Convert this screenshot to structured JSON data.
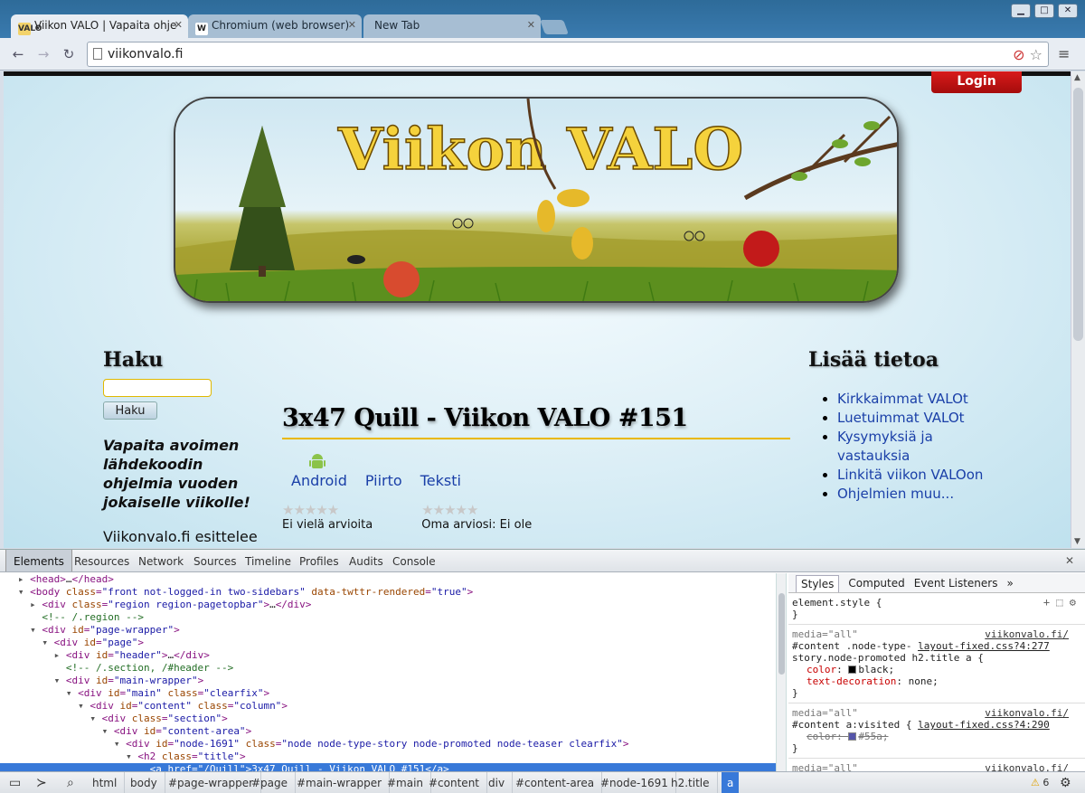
{
  "window": {
    "tabs": [
      {
        "title": "Viikon VALO | Vapaita ohje",
        "favicon": "VALO",
        "active": true
      },
      {
        "title": "Chromium (web browser)",
        "favicon": "W",
        "active": false
      },
      {
        "title": "New Tab",
        "favicon": "",
        "active": false
      }
    ]
  },
  "toolbar": {
    "url": "viikonvalo.fi"
  },
  "page": {
    "login_label": "Login",
    "banner_title": "Viikon VALO",
    "search": {
      "heading": "Haku",
      "button": "Haku"
    },
    "slogan": "Vapaita avoimen lähdekoodin ohjelmia vuoden jokaiselle viikolle!",
    "intro": "Viikonvalo.fi esittelee",
    "node": {
      "title": "3x47 Quill - Viikon VALO #151",
      "tags": [
        "Android",
        "Piirto",
        "Teksti"
      ],
      "rating_left": "Ei vielä arvioita",
      "rating_right": "Oma arviosi: Ei ole"
    },
    "more_info": {
      "heading": "Lisää tietoa",
      "links": [
        "Kirkkaimmat VALOt",
        "Luetuimmat VALOt",
        "Kysymyksiä ja vastauksia",
        "Linkitä viikon VALOon",
        "Ohjelmien muu..."
      ]
    }
  },
  "devtools": {
    "tabs": [
      "Elements",
      "Resources",
      "Network",
      "Sources",
      "Timeline",
      "Profiles",
      "Audits",
      "Console"
    ],
    "dom_lines": [
      {
        "indent": 2,
        "tri": "▸",
        "parts": [
          [
            "tag",
            "<head>"
          ],
          [
            "text",
            "…"
          ],
          [
            "tag",
            "</head>"
          ]
        ]
      },
      {
        "indent": 2,
        "tri": "▾",
        "parts": [
          [
            "tag",
            "<body "
          ],
          [
            "attr",
            "class"
          ],
          [
            "tag",
            "="
          ],
          [
            "val",
            "\"front not-logged-in two-sidebars\""
          ],
          [
            "tag",
            " "
          ],
          [
            "attr",
            "data-twttr-rendered"
          ],
          [
            "tag",
            "="
          ],
          [
            "val",
            "\"true\""
          ],
          [
            "tag",
            ">"
          ]
        ]
      },
      {
        "indent": 3,
        "tri": "▸",
        "parts": [
          [
            "tag",
            "<div "
          ],
          [
            "attr",
            "class"
          ],
          [
            "tag",
            "="
          ],
          [
            "val",
            "\"region region-pagetopbar\""
          ],
          [
            "tag",
            ">"
          ],
          [
            "text",
            "…"
          ],
          [
            "tag",
            "</div>"
          ]
        ]
      },
      {
        "indent": 3,
        "tri": "",
        "parts": [
          [
            "comment",
            "<!-- /.region -->"
          ]
        ]
      },
      {
        "indent": 3,
        "tri": "▾",
        "parts": [
          [
            "tag",
            "<div "
          ],
          [
            "attr",
            "id"
          ],
          [
            "tag",
            "="
          ],
          [
            "val",
            "\"page-wrapper\""
          ],
          [
            "tag",
            ">"
          ]
        ]
      },
      {
        "indent": 4,
        "tri": "▾",
        "parts": [
          [
            "tag",
            "<div "
          ],
          [
            "attr",
            "id"
          ],
          [
            "tag",
            "="
          ],
          [
            "val",
            "\"page\""
          ],
          [
            "tag",
            ">"
          ]
        ]
      },
      {
        "indent": 5,
        "tri": "▸",
        "parts": [
          [
            "tag",
            "<div "
          ],
          [
            "attr",
            "id"
          ],
          [
            "tag",
            "="
          ],
          [
            "val",
            "\"header\""
          ],
          [
            "tag",
            ">"
          ],
          [
            "text",
            "…"
          ],
          [
            "tag",
            "</div>"
          ]
        ]
      },
      {
        "indent": 5,
        "tri": "",
        "parts": [
          [
            "comment",
            "<!-- /.section, /#header -->"
          ]
        ]
      },
      {
        "indent": 5,
        "tri": "▾",
        "parts": [
          [
            "tag",
            "<div "
          ],
          [
            "attr",
            "id"
          ],
          [
            "tag",
            "="
          ],
          [
            "val",
            "\"main-wrapper\""
          ],
          [
            "tag",
            ">"
          ]
        ]
      },
      {
        "indent": 6,
        "tri": "▾",
        "parts": [
          [
            "tag",
            "<div "
          ],
          [
            "attr",
            "id"
          ],
          [
            "tag",
            "="
          ],
          [
            "val",
            "\"main\""
          ],
          [
            "tag",
            " "
          ],
          [
            "attr",
            "class"
          ],
          [
            "tag",
            "="
          ],
          [
            "val",
            "\"clearfix\""
          ],
          [
            "tag",
            ">"
          ]
        ]
      },
      {
        "indent": 7,
        "tri": "▾",
        "parts": [
          [
            "tag",
            "<div "
          ],
          [
            "attr",
            "id"
          ],
          [
            "tag",
            "="
          ],
          [
            "val",
            "\"content\""
          ],
          [
            "tag",
            " "
          ],
          [
            "attr",
            "class"
          ],
          [
            "tag",
            "="
          ],
          [
            "val",
            "\"column\""
          ],
          [
            "tag",
            ">"
          ]
        ]
      },
      {
        "indent": 8,
        "tri": "▾",
        "parts": [
          [
            "tag",
            "<div "
          ],
          [
            "attr",
            "class"
          ],
          [
            "tag",
            "="
          ],
          [
            "val",
            "\"section\""
          ],
          [
            "tag",
            ">"
          ]
        ]
      },
      {
        "indent": 9,
        "tri": "▾",
        "parts": [
          [
            "tag",
            "<div "
          ],
          [
            "attr",
            "id"
          ],
          [
            "tag",
            "="
          ],
          [
            "val",
            "\"content-area\""
          ],
          [
            "tag",
            ">"
          ]
        ]
      },
      {
        "indent": 10,
        "tri": "▾",
        "parts": [
          [
            "tag",
            "<div "
          ],
          [
            "attr",
            "id"
          ],
          [
            "tag",
            "="
          ],
          [
            "val",
            "\"node-1691\""
          ],
          [
            "tag",
            " "
          ],
          [
            "attr",
            "class"
          ],
          [
            "tag",
            "="
          ],
          [
            "val",
            "\"node node-type-story node-promoted node-teaser clearfix\""
          ],
          [
            "tag",
            ">"
          ]
        ]
      },
      {
        "indent": 11,
        "tri": "▾",
        "parts": [
          [
            "tag",
            "<h2 "
          ],
          [
            "attr",
            "class"
          ],
          [
            "tag",
            "="
          ],
          [
            "val",
            "\"title\""
          ],
          [
            "tag",
            ">"
          ]
        ]
      },
      {
        "indent": 12,
        "tri": "",
        "selected": true,
        "parts": [
          [
            "tag",
            "<a "
          ],
          [
            "attr",
            "href"
          ],
          [
            "tag",
            "="
          ],
          [
            "val",
            "\"/Quill\""
          ],
          [
            "tag",
            ">"
          ],
          [
            "text",
            "3x47 Quill - Viikon VALO #151"
          ],
          [
            "tag",
            "</a>"
          ]
        ]
      }
    ],
    "styles": {
      "tabs": [
        "Styles",
        "Computed",
        "Event Listeners"
      ],
      "element_style": "element.style {",
      "rule1": {
        "media": "media=\"all\"",
        "source": "viikonvalo.fi/",
        "selector1": "#content .node-type-",
        "source2": "layout-fixed.css?4:277",
        "selector2": "story.node-promoted h2.title a {",
        "prop1": "color",
        "val1": "black;",
        "prop2": "text-decoration",
        "val2": "none;"
      },
      "rule2": {
        "media": "media=\"all\"",
        "source": "viikonvalo.fi/",
        "selector": "#content a:visited {",
        "source2": "layout-fixed.css?4:290",
        "prop": "color",
        "val": "#55a;"
      },
      "rule3_media": "media=\"all\"",
      "rule3_source": "viikonvalo.fi/"
    },
    "breadcrumbs": [
      "html",
      "body",
      "#page-wrapper",
      "#page",
      "#main-wrapper",
      "#main",
      "#content",
      "div",
      "#content-area",
      "#node-1691",
      "h2.title",
      "a"
    ],
    "warning_count": "6"
  }
}
